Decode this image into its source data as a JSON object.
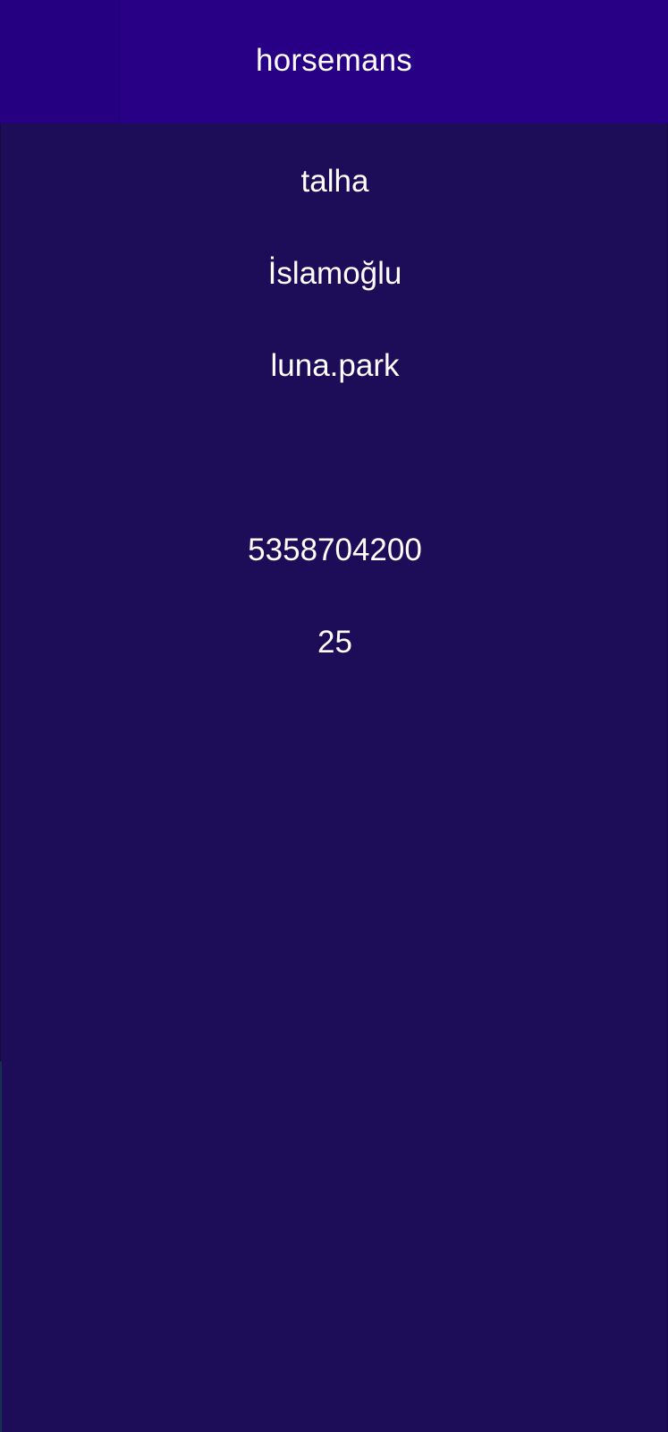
{
  "app_bar": {
    "title": "horsemans"
  },
  "profile": {
    "first_name": "talha",
    "last_name": "İslamoğlu",
    "username": "luna.park",
    "email": "",
    "phone": "5358704200",
    "age": "25"
  },
  "colors": {
    "app_bar": "#270085",
    "background": "#1d0c57",
    "text": "#ffffff"
  }
}
